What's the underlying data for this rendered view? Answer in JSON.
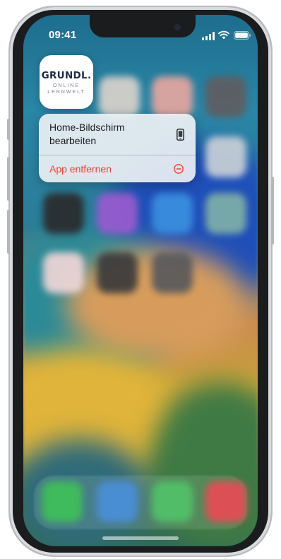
{
  "status_bar": {
    "time": "09:41",
    "icons": [
      "signal-icon",
      "wifi-icon",
      "battery-icon"
    ]
  },
  "app": {
    "name": "GRUNDL.",
    "subtitle_line1": "ONLINE",
    "subtitle_line2": "LERNWELT",
    "brand_color": "#1f2a44"
  },
  "context_menu": {
    "items": [
      {
        "label": "Home-Bildschirm bearbeiten",
        "icon": "phone-icon",
        "destructive": false
      },
      {
        "label": "App entfernen",
        "icon": "minus-circle-icon",
        "destructive": true
      }
    ],
    "destructive_color": "#ff3b30"
  },
  "home_screen": {
    "blurred_app_icons": [
      {
        "name": "app-icon-row1-col2",
        "color": "#d9d2cc"
      },
      {
        "name": "app-icon-row1-col3",
        "color": "#e6a6a0"
      },
      {
        "name": "app-icon-row1-col4",
        "color": "#5f5d60"
      },
      {
        "name": "app-icon-row2-col4",
        "color": "#c9d0d6"
      },
      {
        "name": "app-icon-row3-col1",
        "color": "#2a2a2c"
      },
      {
        "name": "app-icon-row3-col2",
        "color": "#9a5bcf"
      },
      {
        "name": "app-icon-row3-col3",
        "color": "#3a8fe0"
      },
      {
        "name": "app-icon-row3-col4",
        "color": "#7fb0a8"
      },
      {
        "name": "app-icon-row4-col1",
        "color": "#f0d6d8"
      },
      {
        "name": "app-icon-row4-col2",
        "color": "#3a3a3c"
      },
      {
        "name": "app-icon-row4-col3",
        "color": "#58595c"
      }
    ],
    "dock_icons": [
      {
        "name": "phone-app-icon",
        "color": "#3fbf5a"
      },
      {
        "name": "safari-app-icon",
        "color": "#4a8fd9"
      },
      {
        "name": "messages-app-icon",
        "color": "#52c26a"
      },
      {
        "name": "music-app-icon",
        "color": "#e84b55"
      }
    ]
  }
}
